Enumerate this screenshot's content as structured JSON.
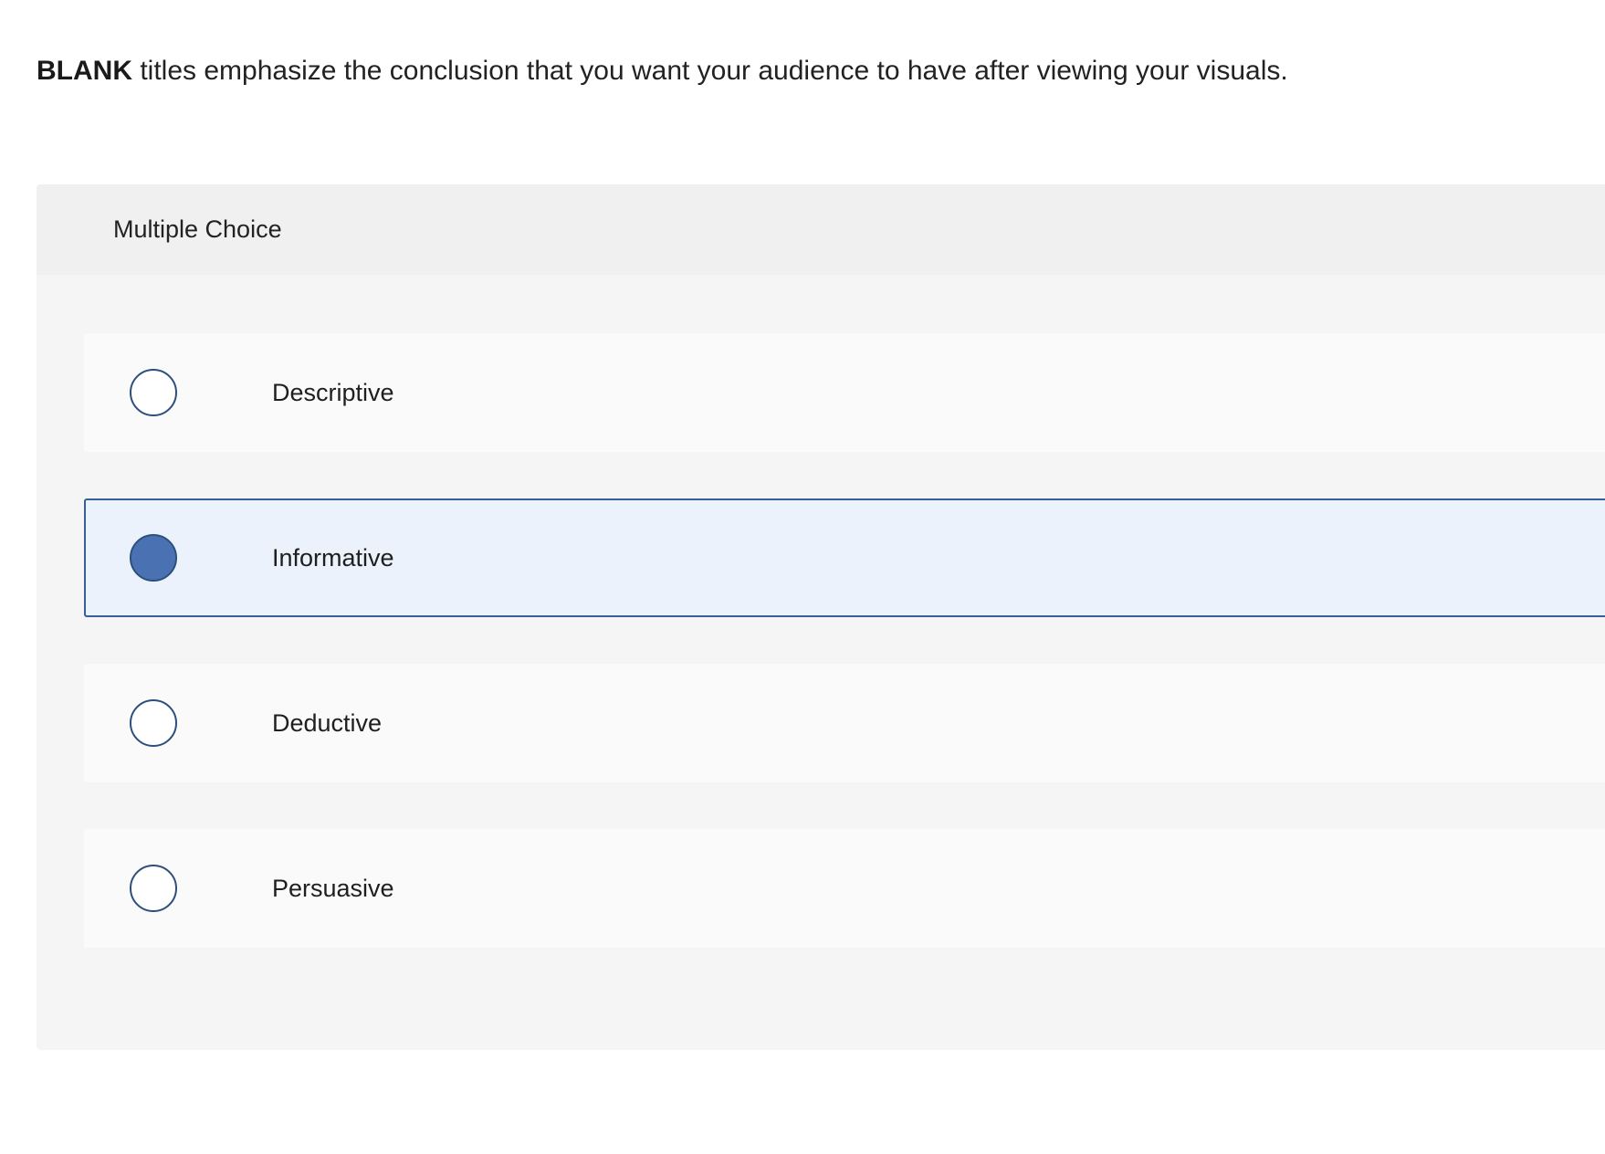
{
  "question": {
    "blank_word": "BLANK",
    "text": " titles emphasize the conclusion that you want your audience to have after viewing your visuals."
  },
  "panel": {
    "header": "Multiple Choice"
  },
  "options": [
    {
      "label": "Descriptive",
      "selected": false
    },
    {
      "label": "Informative",
      "selected": true
    },
    {
      "label": "Deductive",
      "selected": false
    },
    {
      "label": "Persuasive",
      "selected": false
    }
  ],
  "colors": {
    "selected_fill": "#4a72b2",
    "selected_background": "#ebf2fb",
    "radio_border": "#2e4f7c"
  }
}
